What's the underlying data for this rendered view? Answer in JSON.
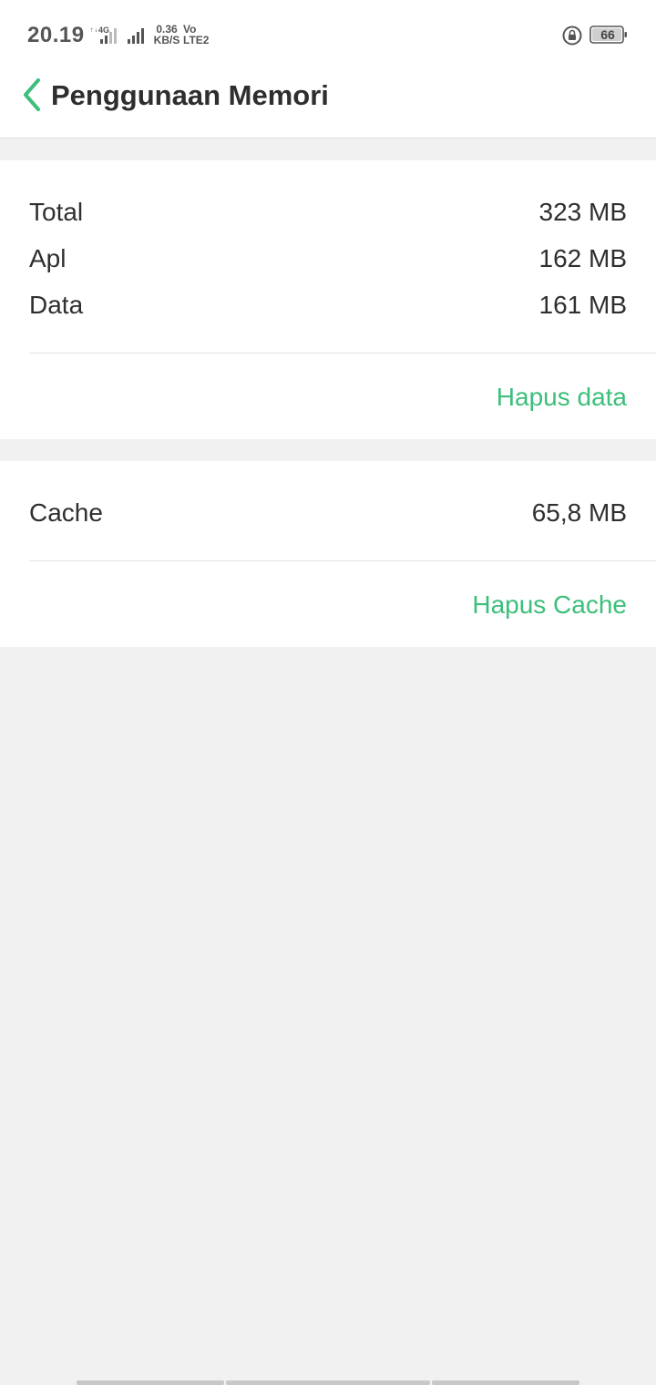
{
  "status_bar": {
    "time": "20.19",
    "network_type": "4G",
    "speed_value": "0.36",
    "speed_unit": "KB/S",
    "volte_top": "Vo",
    "volte_bottom": "LTE2",
    "battery_level": "66",
    "icons": [
      "signal-sim1-icon",
      "signal-sim2-icon",
      "rotation-lock-icon",
      "battery-icon"
    ]
  },
  "header": {
    "back_icon": "chevron-left-icon",
    "title": "Penggunaan Memori"
  },
  "storage": {
    "rows": [
      {
        "label": "Total",
        "value": "323 MB"
      },
      {
        "label": "Apl",
        "value": "162 MB"
      },
      {
        "label": "Data",
        "value": "161 MB"
      }
    ],
    "action": "Hapus data"
  },
  "cache": {
    "label": "Cache",
    "value": "65,8 MB",
    "action": "Hapus Cache"
  },
  "colors": {
    "accent": "#3cbf7a",
    "background": "#f1f1f1",
    "card": "#ffffff",
    "text": "#2f2f2f"
  }
}
